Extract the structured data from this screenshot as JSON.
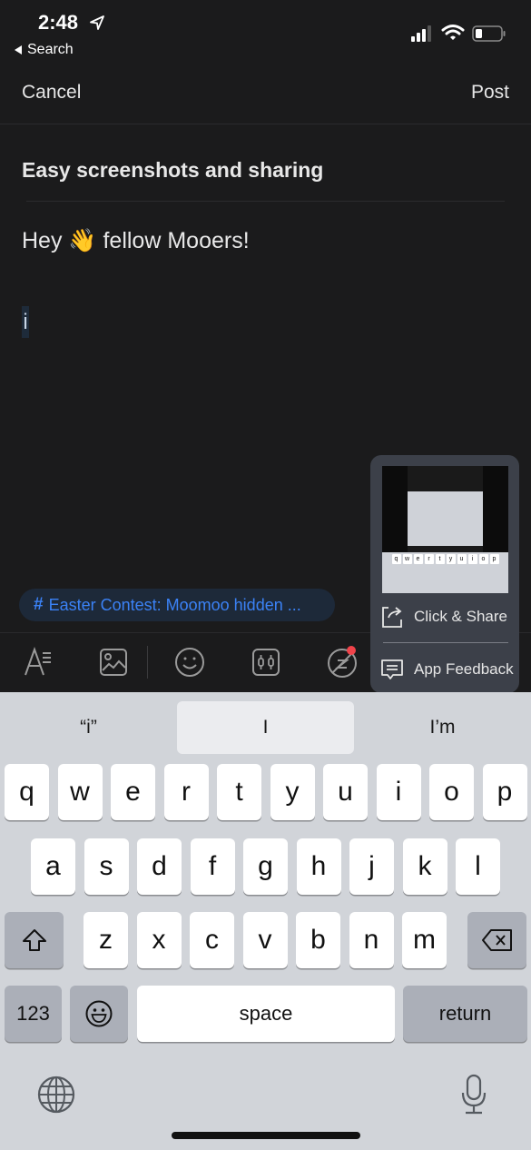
{
  "status_bar": {
    "time": "2:48",
    "back_label": "Search",
    "icons": [
      "location-arrow-icon",
      "cellular-signal-icon",
      "wifi-icon",
      "battery-icon"
    ]
  },
  "nav": {
    "cancel_label": "Cancel",
    "post_label": "Post"
  },
  "editor": {
    "title": "Easy screenshots and sharing",
    "body_line": "Hey 👋 fellow Mooers!",
    "current_input": "i"
  },
  "topic_chip": {
    "hash": "#",
    "label": "Easter Contest: Moomoo hidden ..."
  },
  "toolbar": {
    "items": [
      "text-format-icon",
      "image-icon",
      "emoji-icon",
      "stock-icon",
      "mention-icon",
      "add-icon",
      "more-icon"
    ],
    "notification_dot_color": "#f0434a"
  },
  "popup": {
    "items": [
      {
        "label": "Click & Share",
        "icon": "share-icon"
      },
      {
        "label": "App Feedback",
        "icon": "feedback-icon"
      }
    ],
    "thumb": {
      "row1": [
        "q",
        "w",
        "e",
        "r",
        "t",
        "y",
        "u",
        "i",
        "o",
        "p"
      ]
    }
  },
  "keyboard": {
    "suggestions": [
      "“i”",
      "I",
      "I’m"
    ],
    "row1": [
      "q",
      "w",
      "e",
      "r",
      "t",
      "y",
      "u",
      "i",
      "o",
      "p"
    ],
    "row2": [
      "a",
      "s",
      "d",
      "f",
      "g",
      "h",
      "j",
      "k",
      "l"
    ],
    "row3": [
      "z",
      "x",
      "c",
      "v",
      "b",
      "n",
      "m"
    ],
    "numbers_label": "123",
    "space_label": "space",
    "return_label": "return"
  },
  "colors": {
    "background": "#1b1b1c",
    "accent": "#3b82f6",
    "keyboard_bg": "#d1d4d9"
  }
}
